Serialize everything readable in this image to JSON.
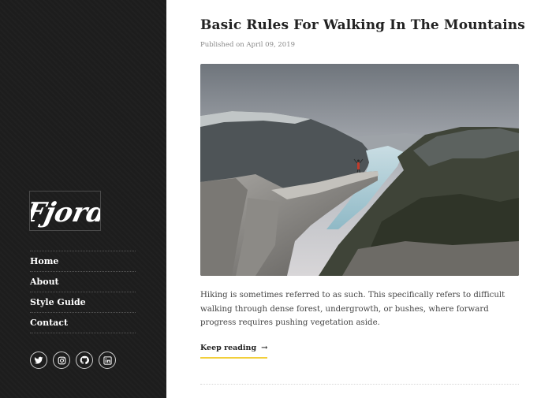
{
  "site": {
    "logo_text": "Fjord"
  },
  "nav": {
    "items": [
      {
        "label": "Home"
      },
      {
        "label": "About"
      },
      {
        "label": "Style Guide"
      },
      {
        "label": "Contact"
      }
    ]
  },
  "social": [
    {
      "icon": "twitter-icon"
    },
    {
      "icon": "instagram-icon"
    },
    {
      "icon": "github-icon"
    },
    {
      "icon": "linkedin-icon"
    }
  ],
  "post": {
    "title": "Basic Rules For Walking In The Mountains",
    "meta": "Published on April 09, 2019",
    "excerpt": "Hiking is sometimes referred to as such. This specifically refers to difficult walking through dense forest, undergrowth, or bushes, where forward progress requires pushing vegetation aside.",
    "read_more": "Keep reading"
  },
  "colors": {
    "sidebar_bg": "#1d1d1d",
    "accent_underline": "#f2cf3b"
  }
}
